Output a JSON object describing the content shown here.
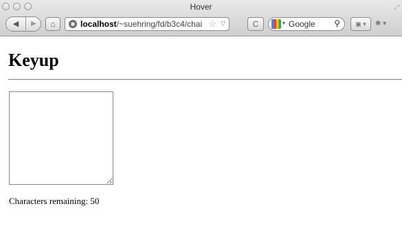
{
  "window": {
    "title": "Hover"
  },
  "toolbar": {
    "url_host": "localhost",
    "url_path": "/~suehring/fd/b3c4/chai",
    "search_engine": "Google"
  },
  "page": {
    "heading": "Keyup",
    "textarea_value": "",
    "counter_label": "Characters remaining:",
    "counter_value": "50"
  }
}
